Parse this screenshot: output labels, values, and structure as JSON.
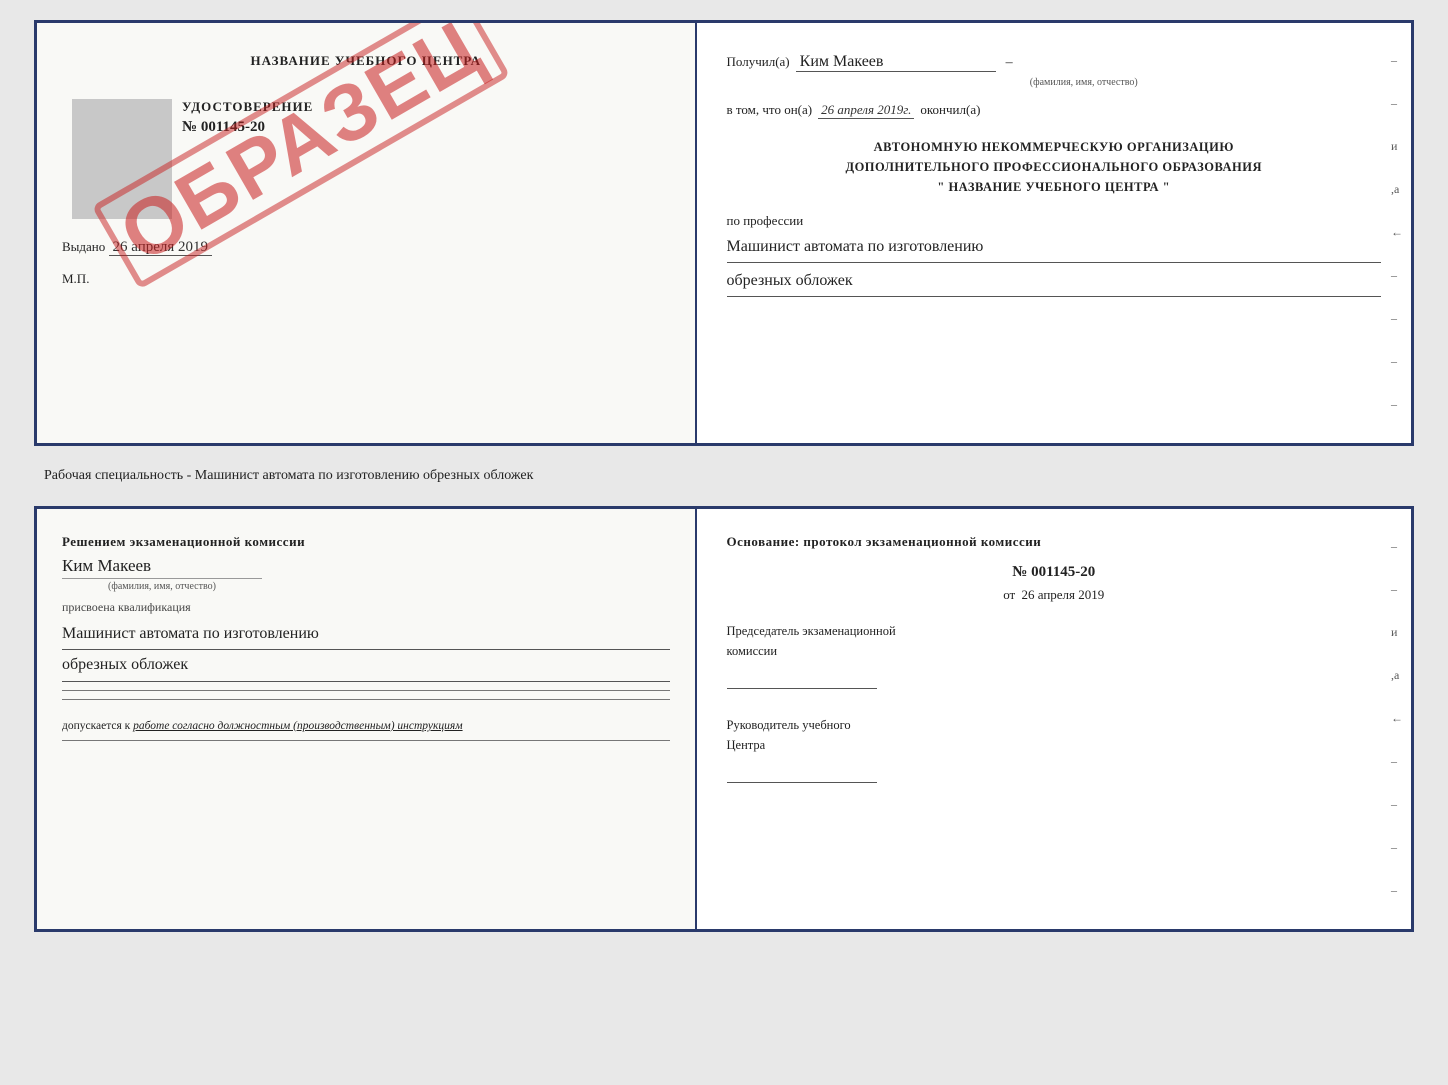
{
  "doc1": {
    "left": {
      "center_title": "НАЗВАНИЕ УЧЕБНОГО ЦЕНТРА",
      "stamp": "ОБРАЗЕЦ",
      "udostoverenie_label": "УДОСТОВЕРЕНИЕ",
      "udostoverenie_number": "№ 001145-20",
      "vydano_label": "Выдано",
      "vydano_date": "26 апреля 2019",
      "mp_label": "М.П."
    },
    "right": {
      "poluchil_label": "Получил(а)",
      "poluchil_name": "Ким Макеев",
      "fio_hint": "(фамилия, имя, отчество)",
      "vtom_label": "в том, что он(а)",
      "vtom_date": "26 апреля 2019г.",
      "okonchil_label": "окончил(а)",
      "org_line1": "АВТОНОМНУЮ НЕКОММЕРЧЕСКУЮ ОРГАНИЗАЦИЮ",
      "org_line2": "ДОПОЛНИТЕЛЬНОГО ПРОФЕССИОНАЛЬНОГО ОБРАЗОВАНИЯ",
      "org_line3": "\" НАЗВАНИЕ УЧЕБНОГО ЦЕНТРА \"",
      "po_professii_label": "по профессии",
      "profession_line1": "Машинист автомата по изготовлению",
      "profession_line2": "обрезных обложек"
    }
  },
  "between": {
    "text": "Рабочая специальность - Машинист автомата по изготовлению обрезных обложек"
  },
  "doc2": {
    "left": {
      "resheniem_label": "Решением экзаменационной комиссии",
      "komissia_name": "Ким Макеев",
      "fio_hint": "(фамилия, имя, отчество)",
      "prisvoena_label": "присвоена квалификация",
      "qualification_line1": "Машинист автомата по изготовлению",
      "qualification_line2": "обрезных обложек",
      "dopusk_prefix": "допускается к",
      "dopusk_italic": "работе согласно должностным (производственным) инструкциям"
    },
    "right": {
      "osnovanie_label": "Основание: протокол экзаменационной комиссии",
      "protocol_number": "№ 001145-20",
      "protocol_date_prefix": "от",
      "protocol_date": "26 апреля 2019",
      "predsedatel_line1": "Председатель экзаменационной",
      "predsedatel_line2": "комиссии",
      "rukovoditel_line1": "Руководитель учебного",
      "rukovoditel_line2": "Центра"
    }
  }
}
